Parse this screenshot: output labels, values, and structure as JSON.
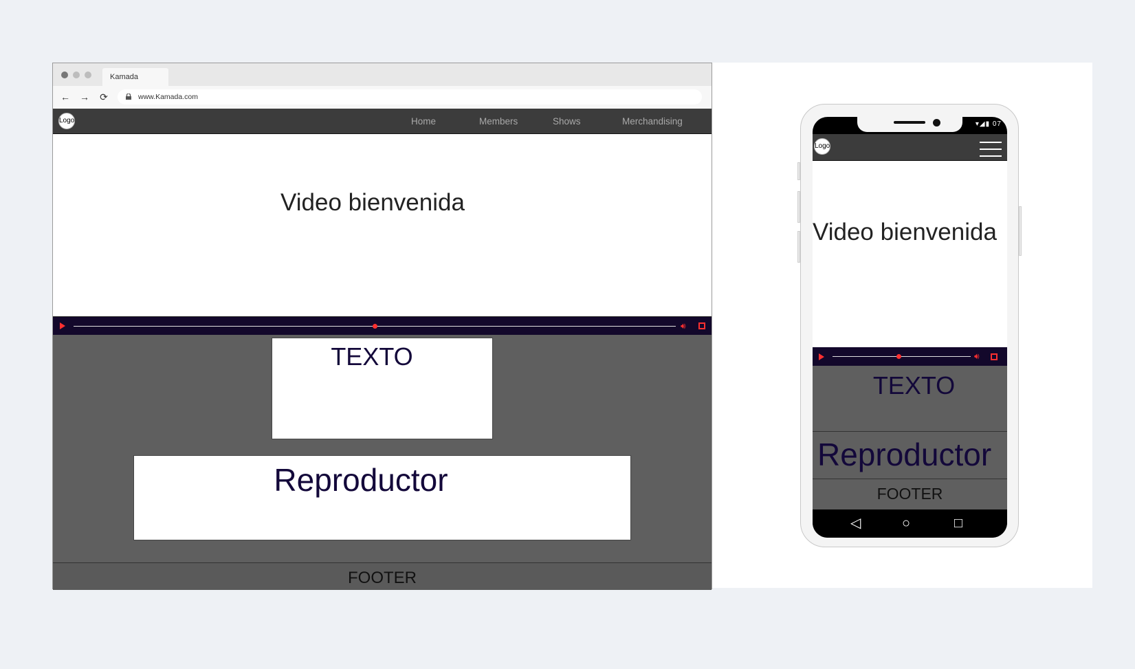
{
  "browser": {
    "tab_title": "Kamada",
    "url": "www.Kamada.com",
    "back_glyph": "←",
    "forward_glyph": "→",
    "reload_glyph": "⟳"
  },
  "site": {
    "logo_label": "Logo",
    "nav": [
      "Home",
      "Members",
      "Shows",
      "Merchandising"
    ]
  },
  "desktop": {
    "video_title": "Video bienvenida",
    "video_progress": 0.5,
    "texto_label": "TEXTO",
    "reproductor_label": "Reproductor",
    "footer_label": "FOOTER"
  },
  "mobile": {
    "status_text": "▾◢▮ 07",
    "video_title": "Video bienvenida",
    "video_progress": 0.48,
    "texto_label": "TEXTO",
    "reproductor_label": "Reproductor",
    "footer_label": "FOOTER",
    "nav_back_glyph": "◁",
    "nav_home_glyph": "○",
    "nav_recent_glyph": "□"
  },
  "colors": {
    "header_bg": "#3c3c3c",
    "content_bg": "#5f5f5f",
    "controls_bg": "#13082b",
    "accent": "#ff3030",
    "heading_text": "#13083a"
  }
}
